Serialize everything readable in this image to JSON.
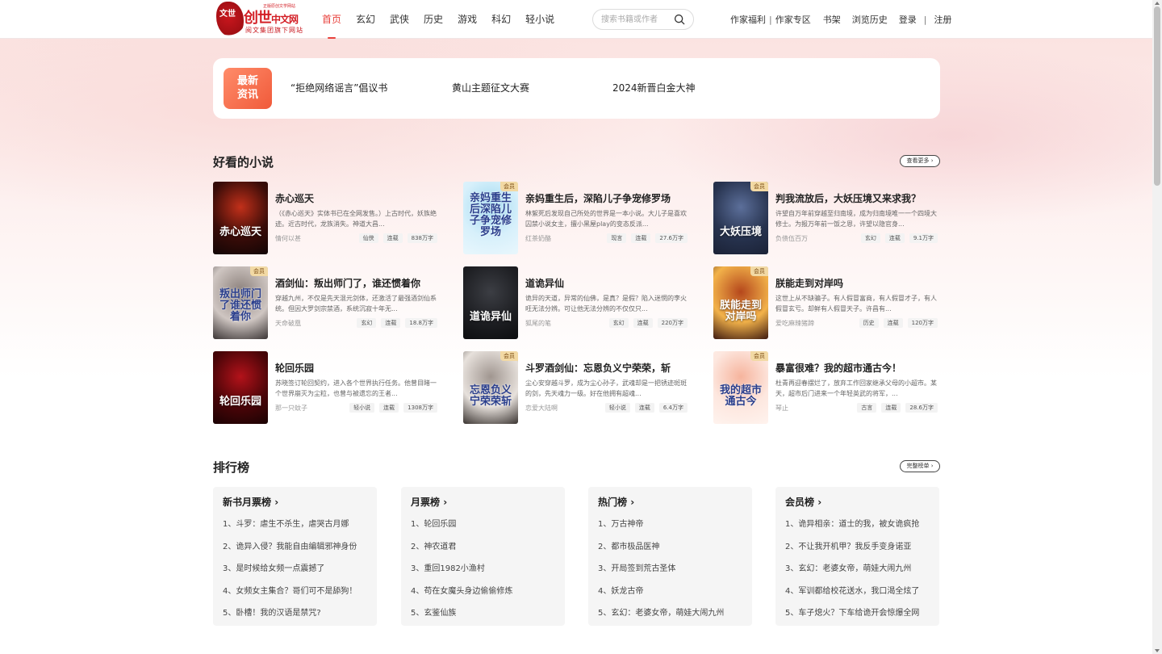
{
  "brand": {
    "logo_main": "创世",
    "logo_main_suffix": "中文网",
    "logo_tagline": "正版原创文学网站",
    "logo_sub": "阅文集团旗下网站",
    "seal_text": "文世"
  },
  "nav": {
    "items": [
      "首页",
      "玄幻",
      "武侠",
      "历史",
      "游戏",
      "科幻",
      "轻小说"
    ],
    "active": "首页"
  },
  "search": {
    "placeholder": "搜索书籍或作者"
  },
  "header_links": {
    "author_welfare": "作家福利",
    "author_zone": "作家专区",
    "bookshelf": "书架",
    "history": "浏览历史",
    "login": "登录",
    "register": "注册",
    "sep": "|"
  },
  "news": {
    "badge": "最新资讯",
    "badge_line1": "最新",
    "badge_line2": "资讯",
    "items": [
      "“拒绝网络谣言”倡议书",
      "黄山主题征文大赛",
      "2024新晋白金大神"
    ]
  },
  "section_good": {
    "title": "好看的小说",
    "more": "查看更多 ›"
  },
  "books": [
    {
      "title": "赤心巡天",
      "desc": "（《赤心巡天》实体书已在全网发售。）上古时代，妖族绝迹。近古时代，龙族消失。神道大昌...",
      "author": "情何以甚",
      "tags": [
        "仙侠",
        "连载",
        "838万字"
      ],
      "vip": false,
      "cover_text": "赤心巡天",
      "cover_colors": [
        "#3a0c08",
        "#c2301a",
        "#120505"
      ]
    },
    {
      "title": "亲妈重生后，深陷儿子争宠修罗场",
      "desc": "林絮死后发现自己所处的世界是一本小说。大儿子是喜欢囚禁小说女主，擅小黑屋play的变态反派...",
      "author": "红茶奶酪",
      "tags": [
        "现言",
        "连载",
        "27.6万字"
      ],
      "vip": true,
      "cover_text": "亲妈重生后深陷儿子争宠修罗场",
      "cover_colors": [
        "#d7f0fb",
        "#9fd9f0",
        "#e9f7fc"
      ]
    },
    {
      "title": "判我流放后，大妖压境又来求我？",
      "desc": "许望自万年前穿越至归南境，成为归南境唯一一个四境大修士。为报万年前一饭之恩，许望以隐官身...",
      "author": "负债伍百万",
      "tags": [
        "玄幻",
        "连载",
        "9.1万字"
      ],
      "vip": true,
      "cover_text": "大妖压境",
      "cover_colors": [
        "#27334f",
        "#5c6f9a",
        "#1b2236"
      ]
    },
    {
      "title": "酒剑仙：叛出师门了，谁还惯着你",
      "desc": "穿越九州，不仅是先天混元剑体，还激活了最强酒剑仙系统。但因大罗剑宗禁酒，系统沉寂十年无...",
      "author": "天命破凰",
      "tags": [
        "玄幻",
        "连载",
        "18.8万字"
      ],
      "vip": true,
      "cover_text": "叛出师门了谁还惯着你",
      "cover_colors": [
        "#cfc6c2",
        "#8a7f7a",
        "#3b3535"
      ]
    },
    {
      "title": "道诡异仙",
      "desc": "诡异的天道，异常的仙佛，是真？是假？陷入迷惘的李火旺无法分辨。可让他无法分辨的不仅仅只...",
      "author": "狐尾的笔",
      "tags": [
        "玄幻",
        "连载",
        "220万字"
      ],
      "vip": false,
      "cover_text": "道诡异仙",
      "cover_colors": [
        "#1e1f23",
        "#3c3e44",
        "#0d0e10"
      ]
    },
    {
      "title": "朕能走到对岸吗",
      "desc": "这世上从不缺骗子。有人假冒富商，有人假冒才子，有人假冒玄亏。却鲜有人假冒天子。许昌有...",
      "author": "爱吃麻辣猪蹄",
      "tags": [
        "历史",
        "连载",
        "120万字"
      ],
      "vip": true,
      "cover_text": "朕能走到对岸吗",
      "cover_colors": [
        "#f2b24a",
        "#b5471c",
        "#3e1a10"
      ]
    },
    {
      "title": "轮回乐园",
      "desc": "苏晓签订轮回契约，进入各个世界执行任务。他曾目睹一个世界崩灭为尘粒，也曾与被遗忘的王者...",
      "author": "那一只蚊子",
      "tags": [
        "轻小说",
        "连载",
        "1308万字"
      ],
      "vip": false,
      "cover_text": "轮回乐园",
      "cover_colors": [
        "#4a0508",
        "#b3121a",
        "#1a0203"
      ]
    },
    {
      "title": "斗罗酒剑仙：忘恩负义宁荣荣，斩",
      "desc": "尘心安穿越斗罗，成为尘心孙子，武魂却是一把锈迹斑斑的剑，先天魂力一级。好在他拥有超魂...",
      "author": "恋爱大陆啊",
      "tags": [
        "轻小说",
        "连载",
        "6.4万字"
      ],
      "vip": true,
      "cover_text": "忘恩负义宁荣荣斩",
      "cover_colors": [
        "#e7e1dc",
        "#a09690",
        "#3a3431"
      ]
    },
    {
      "title": "暴富很难？我的超市通古今！",
      "desc": "杜青再迎春摆烂了，放弃工作回家继承父母的小超市。某天，超市后门进来一个年轻英武的将军，...",
      "author": "琴止",
      "tags": [
        "古言",
        "连载",
        "28.6万字"
      ],
      "vip": true,
      "cover_text": "我的超市通古今",
      "cover_colors": [
        "#fde7df",
        "#f6b49d",
        "#fff3ee"
      ]
    }
  ],
  "section_rank": {
    "title": "排行榜",
    "more": "完整榜单 ›"
  },
  "ranks": [
    {
      "title": "新书月票榜",
      "items": [
        "1、斗罗：虐生不杀生，虐哭古月娜",
        "2、诡异入侵？我能自由编辑邪神身份",
        "3、是时候给女频一点震撼了",
        "4、女频女主集合？哥们可不是舔狗！",
        "5、卧槽！我的汉语是禁咒?"
      ]
    },
    {
      "title": "月票榜",
      "items": [
        "1、轮回乐园",
        "2、神农道君",
        "3、重回1982小渔村",
        "4、苟在女魔头身边偷偷修炼",
        "5、玄鉴仙族"
      ]
    },
    {
      "title": "热门榜",
      "items": [
        "1、万古神帝",
        "2、都市极品医神",
        "3、开局签到荒古圣体",
        "4、妖龙古帝",
        "5、玄幻：老婆女帝，萌娃大闹九州"
      ]
    },
    {
      "title": "会员榜",
      "items": [
        "1、诡异相亲：道士的我，被女诡疯抢",
        "2、不让我开机甲？我反手变身诺亚",
        "3、玄幻：老婆女帝，萌娃大闹九州",
        "4、军训都给校花送水，我口渴全炫了",
        "5、车子熄火？下车给诡开会惊爆全网"
      ]
    }
  ],
  "colors": {
    "accent": "#e8413c",
    "brand_red": "#d31f26",
    "badge": "#f05a3a",
    "vip_bg": "#f2d9a4"
  }
}
